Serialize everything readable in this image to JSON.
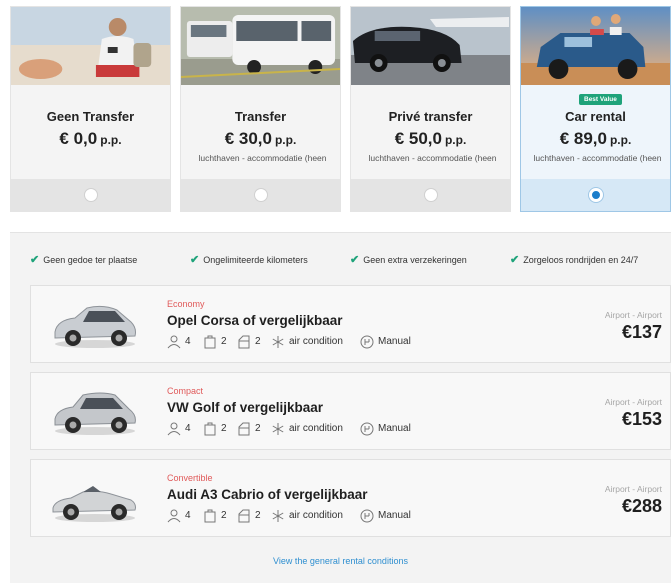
{
  "transfer_options": [
    {
      "name": "Geen Transfer",
      "price": "€ 0,0",
      "per": "p.p.",
      "sub": "",
      "selected": false
    },
    {
      "name": "Transfer",
      "price": "€ 30,0",
      "per": "p.p.",
      "sub": "luchthaven - accommodatie (heen",
      "selected": false
    },
    {
      "name": "Privé transfer",
      "price": "€ 50,0",
      "per": "p.p.",
      "sub": "luchthaven - accommodatie (heen",
      "selected": false
    },
    {
      "name": "Car rental",
      "price": "€ 89,0",
      "per": "p.p.",
      "sub": "luchthaven - accommodatie (heen",
      "badge": "Best Value",
      "selected": true
    }
  ],
  "features": [
    "Geen gedoe ter plaatse",
    "Ongelimiteerde kilometers",
    "Geen extra verzekeringen",
    "Zorgeloos rondrijden en 24/7"
  ],
  "cars": [
    {
      "category": "Economy",
      "model": "Opel Corsa of vergelijkbaar",
      "seats": "4",
      "bags": "2",
      "doors": "2",
      "aircon": "air condition",
      "transmission": "Manual",
      "route": "Airport - Airport",
      "price": "€137",
      "color": "#c9cdd2"
    },
    {
      "category": "Compact",
      "model": "VW Golf of vergelijkbaar",
      "seats": "4",
      "bags": "2",
      "doors": "2",
      "aircon": "air condition",
      "transmission": "Manual",
      "route": "Airport - Airport",
      "price": "€153",
      "color": "#c4c7cb"
    },
    {
      "category": "Convertible",
      "model": "Audi A3 Cabrio of vergelijkbaar",
      "seats": "4",
      "bags": "2",
      "doors": "2",
      "aircon": "air condition",
      "transmission": "Manual",
      "route": "Airport - Airport",
      "price": "€288",
      "color": "#d2d4d6"
    }
  ],
  "conditions_link": "View the general rental conditions",
  "colors": {
    "accent": "#1d7ecb",
    "check": "#1fa37a",
    "category": "#e05a5a",
    "badge": "#1fa37a",
    "link": "#2f8fd0"
  }
}
